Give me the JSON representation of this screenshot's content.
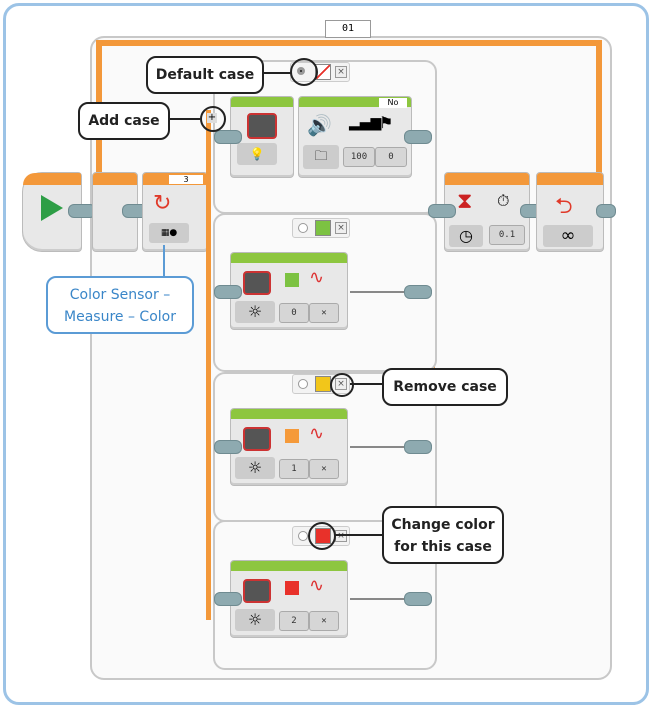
{
  "loop": {
    "label": "01",
    "mode_icon": "infinity-icon",
    "count_display": "3"
  },
  "callouts": {
    "default_case": "Default case",
    "add_case": "Add case",
    "remove_case": "Remove case",
    "change_color": "Change color for this case",
    "color_sensor": "Color Sensor – Measure – Color"
  },
  "cases": [
    {
      "color": "none",
      "block1_icon": "lightbulb-icon",
      "sound": {
        "volume": "100",
        "play_type": "0",
        "wait": "No"
      }
    },
    {
      "color": "#7cc242",
      "value": "0"
    },
    {
      "color": "#f2c61a",
      "value": "1"
    },
    {
      "color": "#e8312a",
      "value": "2"
    }
  ],
  "wait": {
    "seconds": "0.1"
  },
  "colors": {
    "accent_orange": "#f3983a",
    "block_green": "#8dc63f",
    "callout_blue": "#5b9bd5"
  }
}
